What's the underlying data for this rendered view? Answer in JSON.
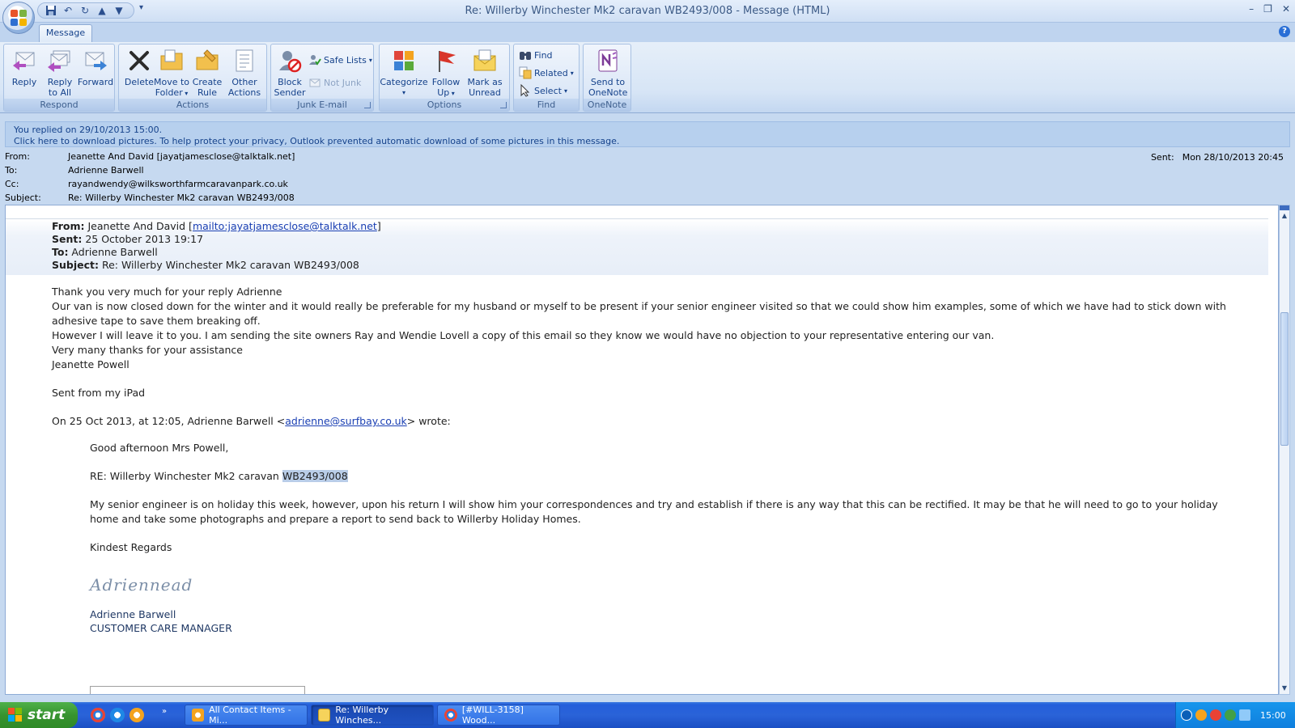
{
  "window": {
    "title": "Re: Willerby Winchester Mk2 caravan WB2493/008 - Message (HTML)",
    "minimize": "–",
    "maximize": "❐",
    "close": "✕"
  },
  "ribbon": {
    "tab": "Message",
    "help": "?",
    "groups": {
      "respond": {
        "label": "Respond",
        "reply": "Reply",
        "reply_all_1": "Reply",
        "reply_all_2": "to All",
        "forward": "Forward"
      },
      "actions": {
        "label": "Actions",
        "delete": "Delete",
        "move_1": "Move to",
        "move_2": "Folder",
        "rule_1": "Create",
        "rule_2": "Rule",
        "other_1": "Other",
        "other_2": "Actions"
      },
      "junk": {
        "label": "Junk E-mail",
        "block_1": "Block",
        "block_2": "Sender",
        "safe_lists": "Safe Lists",
        "not_junk": "Not Junk"
      },
      "options": {
        "label": "Options",
        "categorize": "Categorize",
        "follow_1": "Follow",
        "follow_2": "Up",
        "mark_1": "Mark as",
        "mark_2": "Unread"
      },
      "find": {
        "label": "Find",
        "find": "Find",
        "related": "Related",
        "select": "Select"
      },
      "onenote": {
        "label": "OneNote",
        "send_1": "Send to",
        "send_2": "OneNote"
      }
    }
  },
  "infobar": {
    "line1": "You replied on 29/10/2013 15:00.",
    "line2": "Click here to download pictures. To help protect your privacy, Outlook prevented automatic download of some pictures in this message."
  },
  "headers": {
    "from_label": "From:",
    "from": "Jeanette And David [jayatjamesclose@talktalk.net]",
    "to_label": "To:",
    "to": "Adrienne Barwell",
    "cc_label": "Cc:",
    "cc": "rayandwendy@wilksworthfarmcaravanpark.co.uk",
    "subject_label": "Subject:",
    "subject": "Re: Willerby Winchester Mk2 caravan WB2493/008",
    "sent_label": "Sent:",
    "sent": "Mon 28/10/2013 20:45"
  },
  "message": {
    "q_from_label": "From:",
    "q_from": " Jeanette And David [",
    "q_from_link": "mailto:jayatjamesclose@talktalk.net",
    "q_from_end": "]",
    "q_sent_label": "Sent:",
    "q_sent": " 25 October 2013 19:17",
    "q_to_label": "To:",
    "q_to": " Adrienne Barwell",
    "q_subject_label": "Subject:",
    "q_subject": " Re: Willerby Winchester Mk2 caravan WB2493/008",
    "p1": "Thank you very much for your reply Adrienne",
    "p2a": "Our van is now closed down for the winter and it would really be preferable for my husband or myself to be present if your senior engineer visited so that we could show him examples, some of which we have had to stick down with",
    "p2b": "adhesive tape to save them breaking off.",
    "p3": "However I will leave it to you.  I am sending the site owners Ray and Wendie Lovell a copy of this email so they know we would have no objection to your representative entering our van.",
    "p4": "Very many thanks for your assistance",
    "p5": "Jeanette Powell",
    "p6": "Sent from my iPad",
    "wrote_a": "On 25 Oct 2013, at 12:05, Adrienne Barwell <",
    "wrote_link": "adrienne@surfbay.co.uk",
    "wrote_b": "> wrote:",
    "r1": "Good afternoon Mrs Powell,",
    "r2a": "RE: Willerby Winchester Mk2 caravan ",
    "r2_sel": "WB2493/008",
    "r3a": "My senior engineer is on holiday this week, however, upon his return  I will show him your correspondences and try and establish if there is any way that this can be rectified.   It may be that he will need to go to your holiday",
    "r3b": "home and take some photographs and prepare a report to send back to Willerby Holiday Homes.",
    "r4": "Kindest Regards",
    "signature": "Adriennead",
    "r5": "Adrienne Barwell",
    "r6": "CUSTOMER CARE MANAGER"
  },
  "taskbar": {
    "start": "start",
    "more": "»",
    "tasks": [
      "All Contact Items - Mi...",
      "Re: Willerby Winches...",
      "[#WILL-3158] Wood..."
    ],
    "clock": "15:00"
  }
}
